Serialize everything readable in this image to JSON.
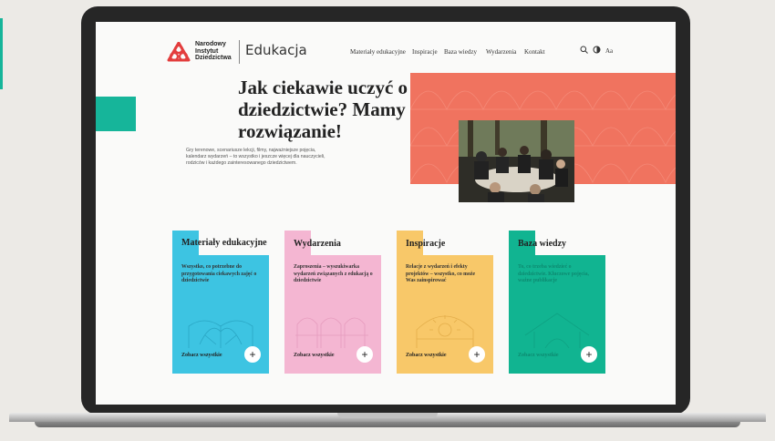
{
  "colors": {
    "teal": "#16b59a",
    "coral": "#f0735f",
    "blue": "#3dc4e2",
    "pink": "#f4b6d2",
    "yellow": "#f8c869",
    "green": "#11b491",
    "logo_red": "#e33d3d"
  },
  "header": {
    "logo_text": "Narodowy Instytut Dziedzictwa",
    "site_name": "Edukacja",
    "nav": [
      "Materiały edukacyjne",
      "Inspiracje",
      "Baza wiedzy",
      "Wydarzenia",
      "Kontakt"
    ],
    "icons": {
      "search": "search-icon",
      "accessibility": "contrast-icon",
      "font_size": "Aa"
    }
  },
  "hero": {
    "title": "Jak ciekawie uczyć o dziedzictwie? Mamy rozwiązanie!",
    "description": "Gry terenowe, scenariusze lekcji, filmy, najważniejsze pojęcia, kalendarz wydarzeń – to wszystko i jeszcze więcej dla nauczycieli, rodziców i każdego zainteresowanego dziedzictwem."
  },
  "cards": [
    {
      "title": "Materiały edukacyjne",
      "description": "Wszystko, co potrzebne do przygotowania ciekawych zajęć o dziedzictwie",
      "link": "Zobacz wszystkie",
      "icon": "book-icon"
    },
    {
      "title": "Wydarzenia",
      "description": "Zaproszenia – wyszukiwarka wydarzeń związanych z edukacją o dziedzictwie",
      "link": "Zobacz wszystkie",
      "icon": "arches-icon"
    },
    {
      "title": "Inspiracje",
      "description": "Relacje z wydarzeń i efekty projektów – wszystko, co może Was zainspirować",
      "link": "Zobacz wszystkie",
      "icon": "sun-arch-icon"
    },
    {
      "title": "Baza wiedzy",
      "description": "To, co trzeba wiedzieć o dziedzictwie. Kluczowe pojęcia, ważne publikacje",
      "link": "Zobacz wszystkie",
      "icon": "roof-icon"
    }
  ]
}
